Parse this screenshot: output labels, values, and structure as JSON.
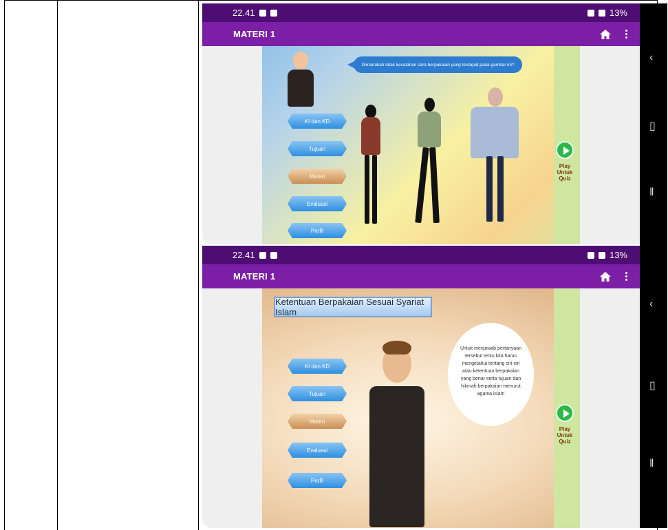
{
  "status_bar": {
    "time": "22.41",
    "right_text": "13%"
  },
  "app_bar": {
    "title": "MATERI 1"
  },
  "screen1": {
    "speech": "Dimanakah letak kesalahan cara berpakaian yang terdapat pada gambar ini?",
    "menu": [
      "KI dan KD",
      "Tujuan",
      "Materi",
      "Evaluasi",
      "Profil"
    ],
    "play_label": [
      "Play",
      "Untuk",
      "Quiz"
    ]
  },
  "screen2": {
    "title": "Ketentuan Berpakaian Sesuai Syariat Islam",
    "bubble": "Untuk menjawab pertanyaan tersebut tentu kita harus mengetahui tentang ciri-ciri atau ketentuan berpakaian yang benar serta tujuan dan hikmah berpakaian menurut agama islam",
    "menu": [
      "KI dan KD",
      "Tujuan",
      "Materi",
      "Evaluasi",
      "Profil"
    ],
    "play_label": [
      "Play",
      "Untuk",
      "Quiz"
    ]
  },
  "colors": {
    "status_bar": "#4e0d73",
    "app_bar": "#7c1fa6",
    "menu_button": "#2f8fe0",
    "play_button": "#2db84a"
  },
  "icons": [
    "home-icon",
    "more-vert-icon",
    "back-icon",
    "home-nav-icon",
    "recent-apps-icon",
    "play-icon"
  ]
}
